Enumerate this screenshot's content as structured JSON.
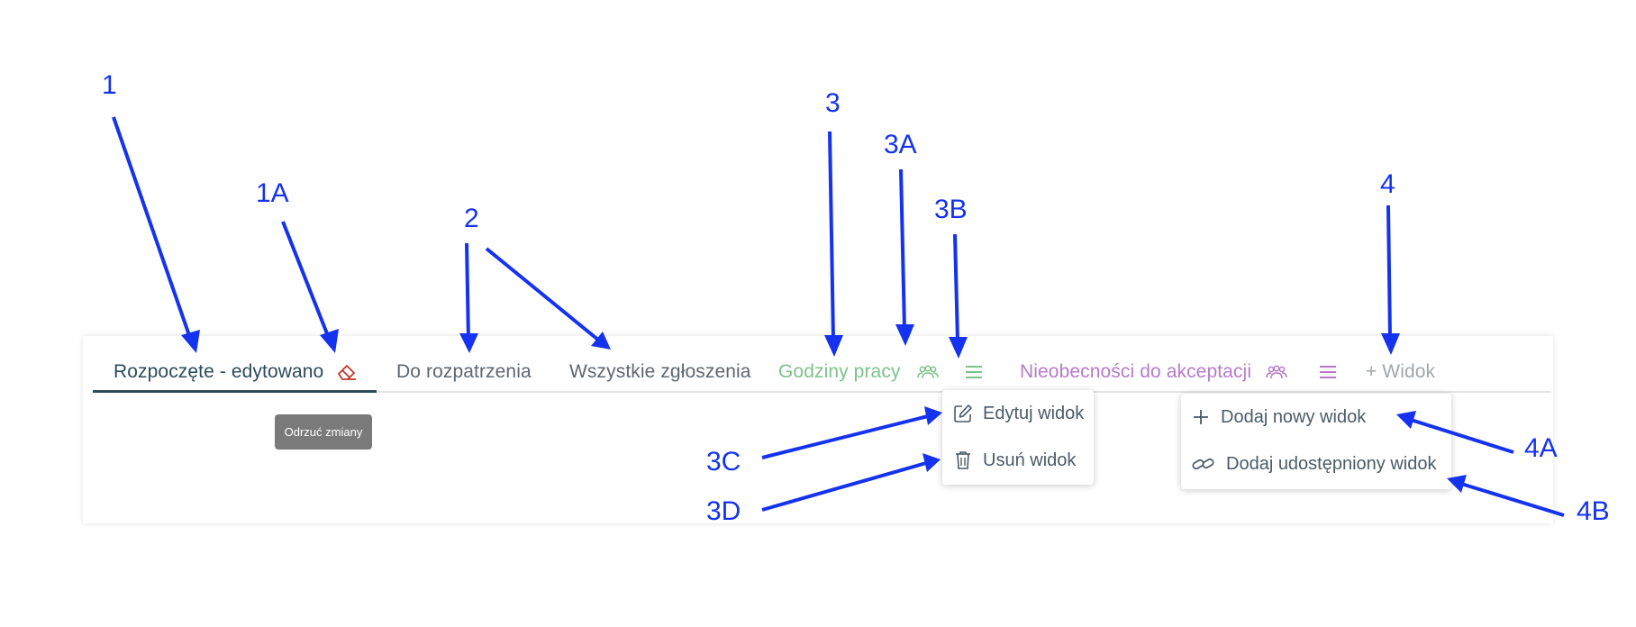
{
  "tabs": [
    {
      "label": "Rozpoczęte - edytowano",
      "color": "#2c4b59",
      "active": true
    },
    {
      "label": "Do rozpatrzenia",
      "color": "#5d6770"
    },
    {
      "label": "Wszystkie zgłoszenia",
      "color": "#5d6770"
    },
    {
      "label": "Godziny pracy",
      "color": "#7cc38a"
    },
    {
      "label": "Nieobecności do akceptacji",
      "color": "#b67acb"
    }
  ],
  "add_view": {
    "label": "+ Widok",
    "color": "#a0a6ab"
  },
  "tooltip": {
    "label": "Odrzuć zmiany"
  },
  "view_menu": {
    "items": [
      "Edytuj widok",
      "Usuń widok"
    ]
  },
  "add_menu": {
    "items": [
      "Dodaj nowy widok",
      "Dodaj udostępniony widok"
    ]
  },
  "callouts": [
    "1",
    "1A",
    "2",
    "3",
    "3A",
    "3B",
    "3C",
    "3D",
    "4",
    "4A",
    "4B"
  ],
  "colors": {
    "callout": "#1432f0",
    "discard_icon": "#c0392b"
  },
  "icons": [
    "eraser-icon",
    "users-icon",
    "hamburger-icon",
    "pencil-square-icon",
    "trash-icon",
    "plus-icon",
    "link-icon"
  ]
}
